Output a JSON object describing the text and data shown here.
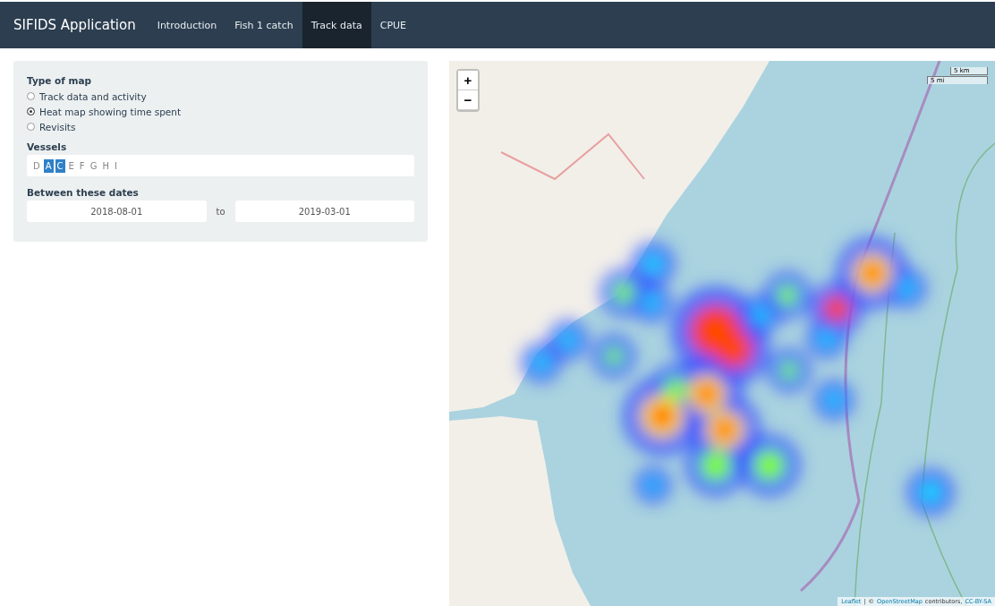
{
  "navbar": {
    "brand": "SIFIDS Application",
    "tabs": [
      {
        "label": "Introduction",
        "selected": false
      },
      {
        "label": "Fish 1 catch",
        "selected": false
      },
      {
        "label": "Track data",
        "selected": true
      },
      {
        "label": "CPUE",
        "selected": false
      }
    ]
  },
  "sidebar": {
    "map_type": {
      "label": "Type of map",
      "options": [
        {
          "label": "Track data and activity",
          "selected": false
        },
        {
          "label": "Heat map showing time spent",
          "selected": true
        },
        {
          "label": "Revisits",
          "selected": false
        }
      ]
    },
    "vessels": {
      "label": "Vessels",
      "items": [
        {
          "label": "D",
          "selected": false
        },
        {
          "label": "A",
          "selected": true
        },
        {
          "label": "C",
          "selected": true
        },
        {
          "label": "E",
          "selected": false
        },
        {
          "label": "F",
          "selected": false
        },
        {
          "label": "G",
          "selected": false
        },
        {
          "label": "H",
          "selected": false
        },
        {
          "label": "I",
          "selected": false
        }
      ]
    },
    "dates": {
      "label": "Between these dates",
      "start": "2018-08-01",
      "separator": "to",
      "end": "2019-03-01"
    }
  },
  "map": {
    "zoom_in": "+",
    "zoom_out": "−",
    "scale": [
      "5 km",
      "5 mi"
    ],
    "attribution": {
      "prefix": "Leaflet",
      "separator": "|",
      "copyright": "©",
      "link": "OpenStreetMap",
      "contributors": "contributors,",
      "license": "CC-BY-SA"
    }
  }
}
